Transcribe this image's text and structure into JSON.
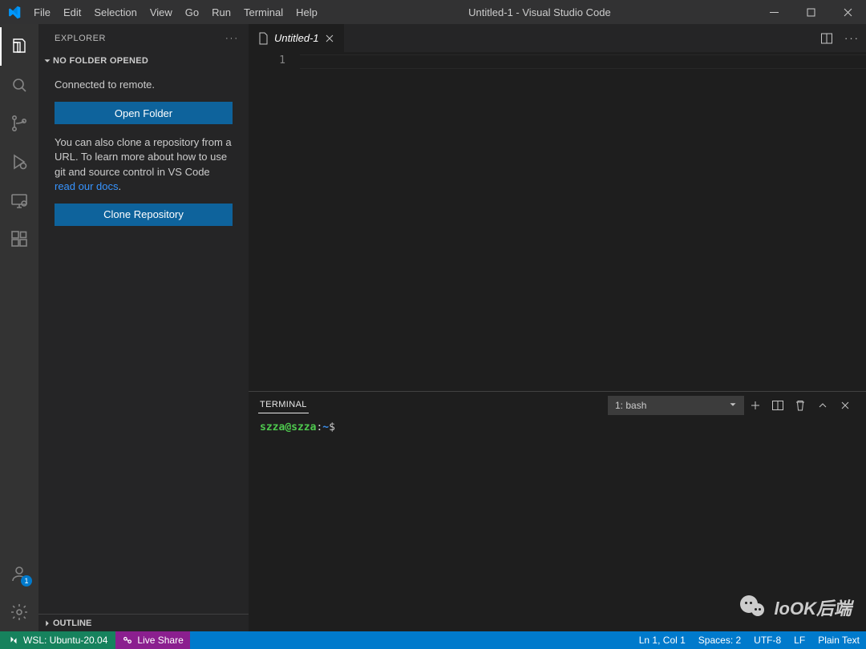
{
  "window": {
    "title": "Untitled-1 - Visual Studio Code"
  },
  "menus": [
    "File",
    "Edit",
    "Selection",
    "View",
    "Go",
    "Run",
    "Terminal",
    "Help"
  ],
  "explorer": {
    "title": "EXPLORER",
    "section": "NO FOLDER OPENED",
    "connected_text": "Connected to remote.",
    "open_folder_label": "Open Folder",
    "clone_help_text": "You can also clone a repository from a URL. To learn more about how to use git and source control in VS Code ",
    "docs_link_text": "read our docs",
    "clone_repo_label": "Clone Repository",
    "outline_label": "OUTLINE"
  },
  "tabs": {
    "active": "Untitled-1"
  },
  "editor": {
    "line_number": "1"
  },
  "terminal": {
    "tab_label": "TERMINAL",
    "selector": "1: bash",
    "prompt_user": "szza",
    "prompt_at": "@",
    "prompt_host": "szza",
    "prompt_colon": ":",
    "prompt_path": "~",
    "prompt_dollar": "$"
  },
  "statusbar": {
    "remote": "WSL: Ubuntu-20.04",
    "liveshare": "Live Share",
    "position": "Ln 1, Col 1",
    "spaces": "Spaces: 2",
    "encoding": "UTF-8",
    "eol": "LF",
    "language": "Plain Text"
  },
  "accounts_badge": "1",
  "watermark_text": "loOK后端"
}
